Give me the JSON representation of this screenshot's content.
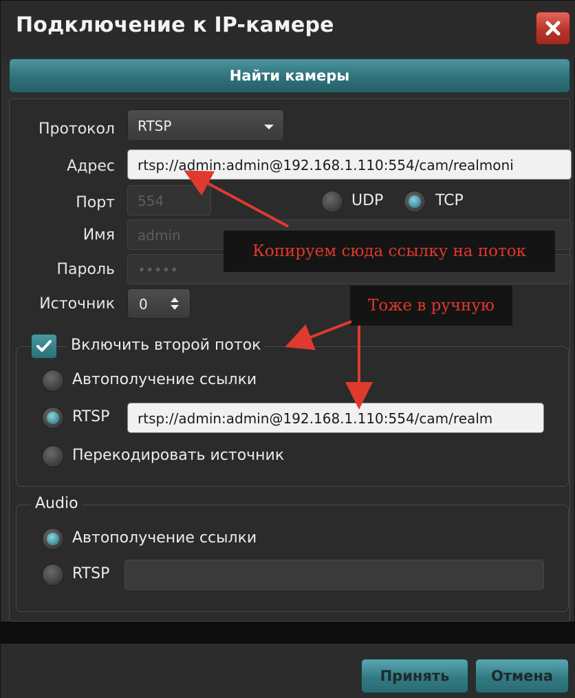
{
  "window": {
    "title": "Подключение к IP-камере",
    "close_icon": "close-icon"
  },
  "toolbar": {
    "find_label": "Найти камеры"
  },
  "form": {
    "protocol_label": "Протокол",
    "protocol_value": "RTSP",
    "address_label": "Адрес",
    "address_value": "rtsp://admin:admin@192.168.1.110:554/cam/realmoni",
    "port_label": "Порт",
    "port_value": "554",
    "udp_label": "UDP",
    "tcp_label": "TCP",
    "transport_selected": "TCP",
    "name_label": "Имя",
    "name_value": "admin",
    "password_label": "Пароль",
    "password_value": "•••••",
    "source_label": "Источник",
    "source_value": "0"
  },
  "second_stream": {
    "checkbox_label": "Включить второй поток",
    "checked": true,
    "auto_label": "Автополучение ссылки",
    "rtsp_label": "RTSP",
    "rtsp_value": "rtsp://admin:admin@192.168.1.110:554/cam/realm",
    "transcode_label": "Перекодировать источник",
    "selected": "RTSP"
  },
  "audio": {
    "legend": "Audio",
    "auto_label": "Автополучение ссылки",
    "rtsp_label": "RTSP",
    "rtsp_value": "",
    "selected": "auto"
  },
  "annotations": {
    "note1": "Копируем сюда ссылку на поток",
    "note2": "Тоже в ручную",
    "text_color": "#e0382c",
    "arrow_color": "#e03a2e"
  },
  "buttons": {
    "accept_label": "Принять",
    "cancel_label": "Отмена"
  },
  "colors": {
    "accent": "#2f727b",
    "close": "#b8352a",
    "background": "#2d2d2d"
  }
}
